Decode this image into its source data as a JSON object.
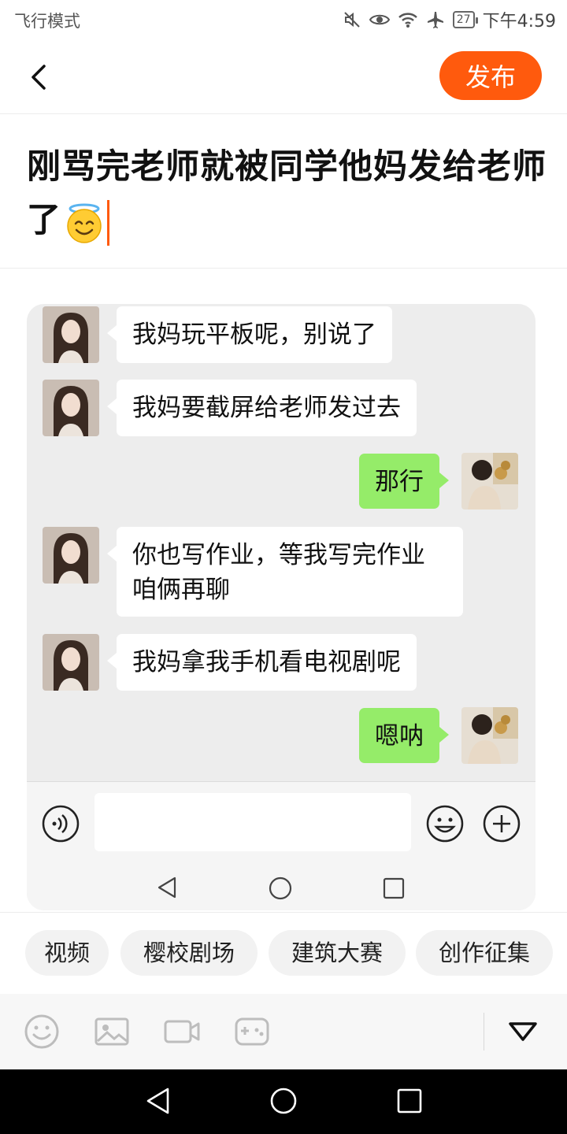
{
  "status_bar": {
    "mode": "飞行模式",
    "battery": "27",
    "time": "下午4:59"
  },
  "header": {
    "publish_label": "发布"
  },
  "post": {
    "title": "刚骂完老师就被同学他妈发给老师了"
  },
  "chat": {
    "messages": [
      {
        "side": "left",
        "text": "我妈玩平板呢，别说了"
      },
      {
        "side": "left",
        "text": "我妈要截屏给老师发过去"
      },
      {
        "side": "right",
        "text": "那行"
      },
      {
        "side": "left",
        "text": "你也写作业，等我写完作业咱俩再聊"
      },
      {
        "side": "left",
        "text": "我妈拿我手机看电视剧呢"
      },
      {
        "side": "right",
        "text": "嗯呐"
      }
    ]
  },
  "tags": [
    "视频",
    "樱校剧场",
    "建筑大赛",
    "创作征集"
  ],
  "icons": {
    "status": [
      "mute-icon",
      "eye-icon",
      "wifi-icon",
      "airplane-icon",
      "battery-icon"
    ],
    "toolbar": [
      "emoji-icon",
      "image-icon",
      "video-icon",
      "game-icon",
      "collapse-icon"
    ]
  },
  "colors": {
    "accent": "#ff5a0d",
    "bubble_out": "#95ec69",
    "chat_bg": "#ededed"
  }
}
